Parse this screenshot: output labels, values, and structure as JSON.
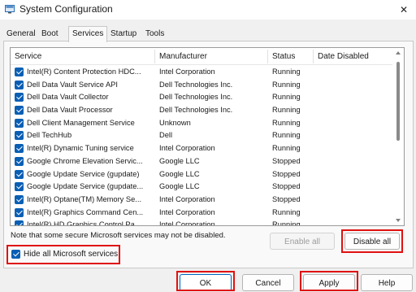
{
  "window": {
    "title": "System Configuration",
    "close_icon": "close-icon",
    "app_icon": "system-config-icon"
  },
  "tabs": [
    {
      "label": "General",
      "active": false
    },
    {
      "label": "Boot",
      "active": false
    },
    {
      "label": "Services",
      "active": true
    },
    {
      "label": "Startup",
      "active": false
    },
    {
      "label": "Tools",
      "active": false
    }
  ],
  "services": {
    "columns": [
      "Service",
      "Manufacturer",
      "Status",
      "Date Disabled"
    ],
    "rows": [
      {
        "name": "Intel(R) Content Protection HDC...",
        "manufacturer": "Intel Corporation",
        "status": "Running",
        "checked": true
      },
      {
        "name": "Dell Data Vault Service API",
        "manufacturer": "Dell Technologies Inc.",
        "status": "Running",
        "checked": true
      },
      {
        "name": "Dell Data Vault Collector",
        "manufacturer": "Dell Technologies Inc.",
        "status": "Running",
        "checked": true
      },
      {
        "name": "Dell Data Vault Processor",
        "manufacturer": "Dell Technologies Inc.",
        "status": "Running",
        "checked": true
      },
      {
        "name": "Dell Client Management Service",
        "manufacturer": "Unknown",
        "status": "Running",
        "checked": true
      },
      {
        "name": "Dell TechHub",
        "manufacturer": "Dell",
        "status": "Running",
        "checked": true
      },
      {
        "name": "Intel(R) Dynamic Tuning service",
        "manufacturer": "Intel Corporation",
        "status": "Running",
        "checked": true
      },
      {
        "name": "Google Chrome Elevation Servic...",
        "manufacturer": "Google LLC",
        "status": "Stopped",
        "checked": true
      },
      {
        "name": "Google Update Service (gupdate)",
        "manufacturer": "Google LLC",
        "status": "Stopped",
        "checked": true
      },
      {
        "name": "Google Update Service (gupdate...",
        "manufacturer": "Google LLC",
        "status": "Stopped",
        "checked": true
      },
      {
        "name": "Intel(R) Optane(TM) Memory Se...",
        "manufacturer": "Intel Corporation",
        "status": "Stopped",
        "checked": true
      },
      {
        "name": "Intel(R) Graphics Command Cen...",
        "manufacturer": "Intel Corporation",
        "status": "Running",
        "checked": true
      },
      {
        "name": "Intel(R) HD Graphics Control Pa...",
        "manufacturer": "Intel Corporation",
        "status": "Running",
        "checked": true
      }
    ]
  },
  "note": "Note that some secure Microsoft services may not be disabled.",
  "buttons": {
    "enable_all": "Enable all",
    "disable_all": "Disable all",
    "ok": "OK",
    "cancel": "Cancel",
    "apply": "Apply",
    "help": "Help"
  },
  "hide_ms": {
    "label": "Hide all Microsoft services",
    "checked": true
  },
  "highlight_color": "#e01111",
  "accent_color": "#0a5fb4"
}
